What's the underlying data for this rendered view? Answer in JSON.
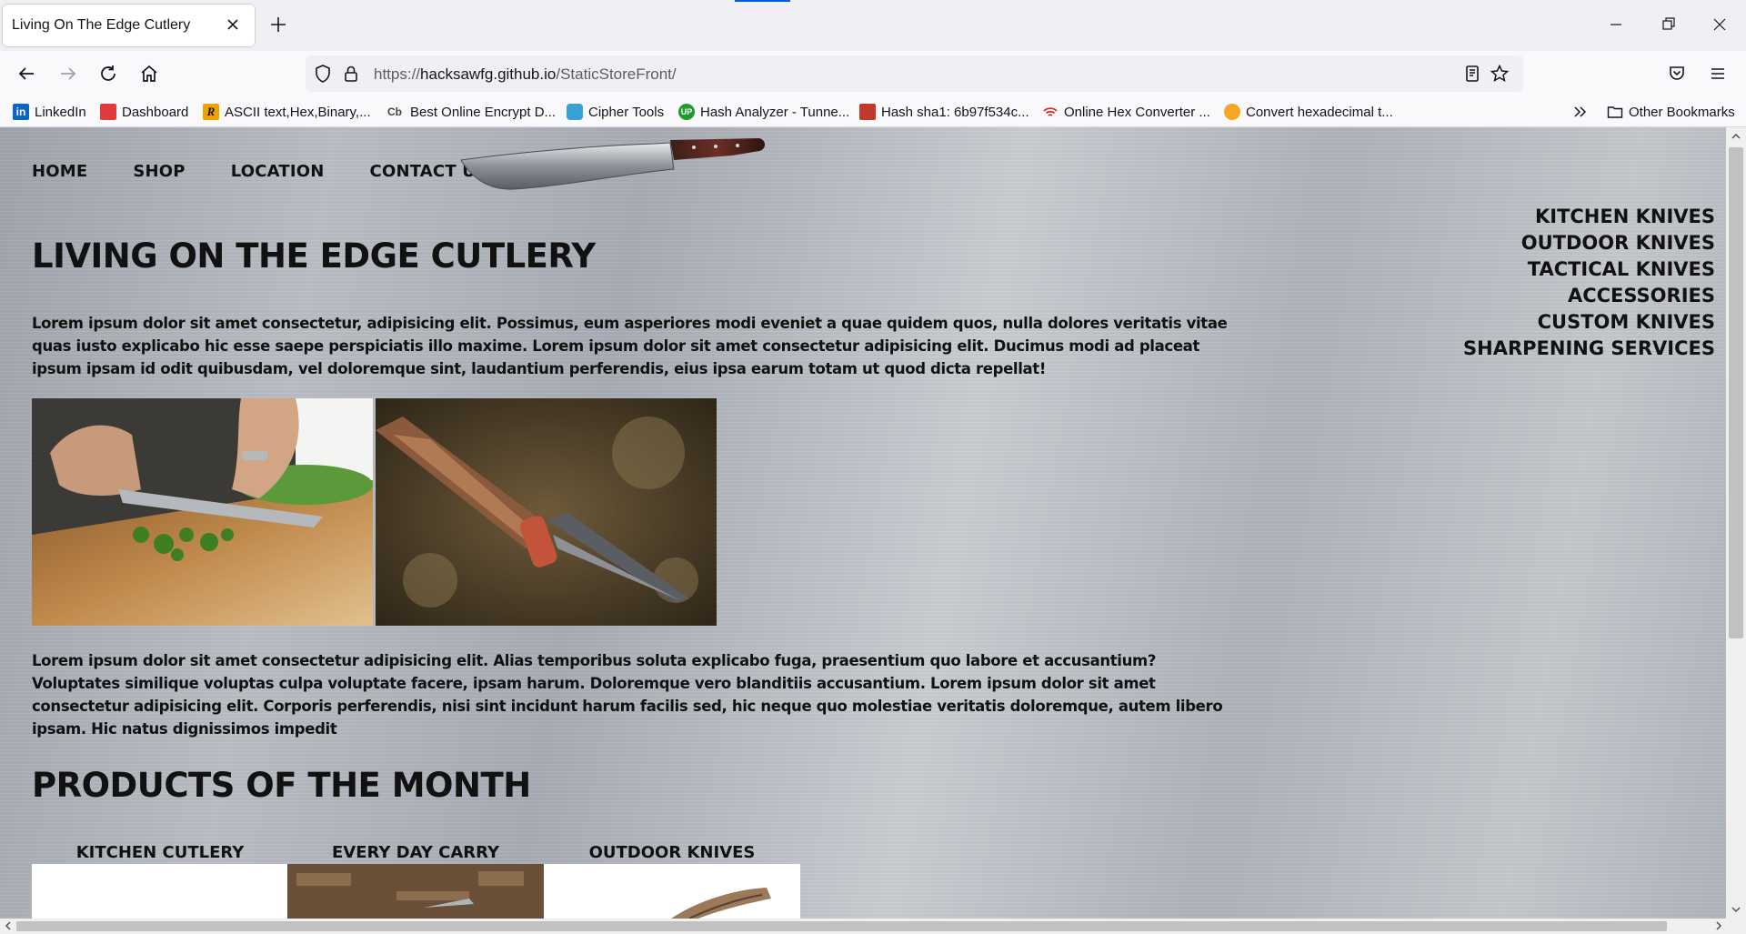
{
  "browser": {
    "tab_title": "Living On The Edge Cutlery",
    "url_scheme": "https://",
    "url_host": "hacksawfg.github.io",
    "url_path": "/StaticStoreFront/",
    "bookmarks": [
      {
        "label": "LinkedIn",
        "icon": "linkedin-icon",
        "color": "#0a66c2"
      },
      {
        "label": "Dashboard",
        "icon": "dashboard-icon",
        "color": "#e03c3c"
      },
      {
        "label": "ASCII text,Hex,Binary,...",
        "icon": "rapidtables-icon",
        "color": "#f2a200"
      },
      {
        "label": "Best Online Encrypt D...",
        "icon": "cb-icon",
        "color": "#444444"
      },
      {
        "label": "Cipher Tools",
        "icon": "cipher-icon",
        "color": "#3aa0d8"
      },
      {
        "label": "Hash Analyzer - Tunne...",
        "icon": "tunnelsup-icon",
        "color": "#1f9a2e"
      },
      {
        "label": "Hash sha1: 6b97f534c...",
        "icon": "hash-icon",
        "color": "#c0392b"
      },
      {
        "label": "Online Hex Converter ...",
        "icon": "wifi-icon",
        "color": "#d32f2f"
      },
      {
        "label": "Convert hexadecimal t...",
        "icon": "convert-icon",
        "color": "#f5a623"
      }
    ],
    "other_bookmarks": "Other Bookmarks"
  },
  "site": {
    "nav": [
      "HOME",
      "SHOP",
      "LOCATION",
      "CONTACT US"
    ],
    "side_menu": [
      "KITCHEN KNIVES",
      "OUTDOOR KNIVES",
      "TACTICAL KNIVES",
      "ACCESSORIES",
      "CUSTOM KNIVES",
      "SHARPENING SERVICES"
    ],
    "title": "LIVING ON THE EDGE CUTLERY",
    "intro": "Lorem ipsum dolor sit amet consectetur, adipisicing elit. Possimus, eum asperiores modi eveniet a quae quidem quos, nulla dolores veritatis vitae quas iusto explicabo hic esse saepe perspiciatis illo maxime. Lorem ipsum dolor sit amet consectetur adipisicing elit. Ducimus modi ad placeat ipsum ipsam id odit quibusdam, vel doloremque sint, laudantium perferendis, eius ipsa earum totam ut quod dicta repellat!",
    "body": "Lorem ipsum dolor sit amet consectetur adipisicing elit. Alias temporibus soluta explicabo fuga, praesentium quo labore et accusantium? Voluptates similique voluptas culpa voluptate facere, ipsam harum. Doloremque vero blanditiis accusantium. Lorem ipsum dolor sit amet consectetur adipisicing elit. Corporis perferendis, nisi sint incidunt harum facilis sed, hic neque quo molestiae veritatis doloremque, autem libero ipsam. Hic natus dignissimos impedit",
    "products_heading": "PRODUCTS OF THE MONTH",
    "products": [
      "KITCHEN CUTLERY",
      "EVERY DAY CARRY",
      "OUTDOOR KNIVES"
    ]
  }
}
